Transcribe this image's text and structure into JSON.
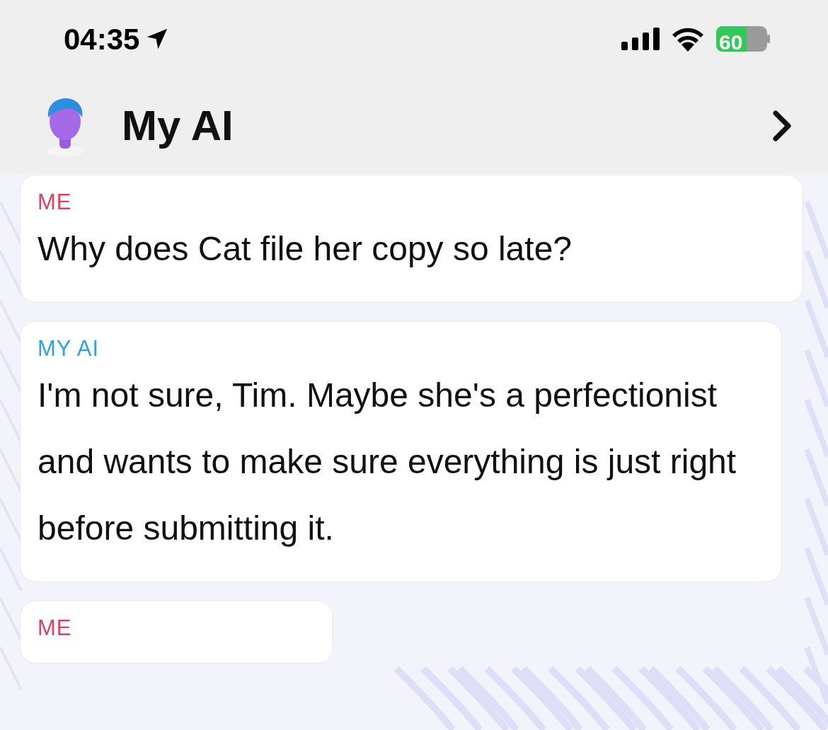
{
  "status_bar": {
    "time": "04:35",
    "battery": "60"
  },
  "header": {
    "title": "My AI"
  },
  "messages": [
    {
      "kind": "me",
      "sender": "ME",
      "text": "Why does Cat file her copy so late?"
    },
    {
      "kind": "ai",
      "sender": "MY AI",
      "text": "I'm not sure, Tim. Maybe she's a perfectionist and wants to make sure everything is just right before submitting it."
    },
    {
      "kind": "me",
      "sender": "ME"
    }
  ]
}
